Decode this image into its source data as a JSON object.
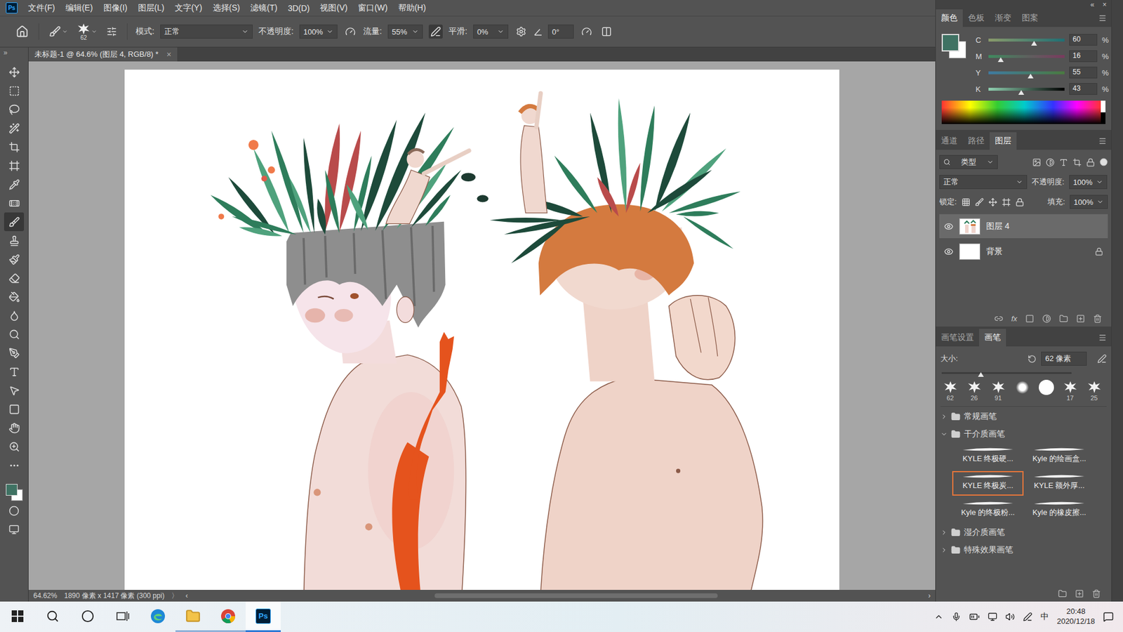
{
  "app": {
    "logo": "Ps"
  },
  "menu": [
    "文件(F)",
    "编辑(E)",
    "图像(I)",
    "图层(L)",
    "文字(Y)",
    "选择(S)",
    "滤镜(T)",
    "3D(D)",
    "视图(V)",
    "窗口(W)",
    "帮助(H)"
  ],
  "options_bar": {
    "brush_size": "62",
    "mode_label": "模式:",
    "mode": "正常",
    "opacity_label": "不透明度:",
    "opacity": "100%",
    "flow_label": "流量:",
    "flow": "55%",
    "airbrush_on": true,
    "smoothing_label": "平滑:",
    "smoothing": "0%",
    "angle": "0°"
  },
  "document_tab": {
    "title": "未标题-1 @ 64.6% (图层 4, RGB/8) *",
    "close": "×"
  },
  "toolbar": {
    "collapse": "»",
    "tools": [
      {
        "selected": false
      },
      {
        "selected": false
      },
      {
        "selected": false
      },
      {
        "selected": false
      },
      {
        "selected": false
      },
      {
        "selected": false
      },
      {
        "selected": false
      },
      {
        "selected": false
      },
      {
        "selected": true
      },
      {
        "selected": false
      },
      {
        "selected": false
      },
      {
        "selected": false
      },
      {
        "selected": false
      },
      {
        "selected": false
      },
      {
        "selected": false
      },
      {
        "selected": false
      },
      {
        "selected": false
      },
      {
        "selected": false
      },
      {
        "selected": false
      },
      {
        "selected": false
      },
      {
        "selected": false
      },
      {
        "selected": false
      }
    ]
  },
  "dock_controls": [
    "«",
    "×"
  ],
  "color_panel": {
    "tabs": [
      {
        "label": "颜色",
        "selected": true
      },
      {
        "label": "色板",
        "selected": false
      },
      {
        "label": "渐变",
        "selected": false
      },
      {
        "label": "图案",
        "selected": false
      }
    ],
    "foreground": "#3f7263",
    "background": "#ffffff",
    "channels": [
      {
        "name": "C",
        "value": "60",
        "unit": "%",
        "level": 0.6
      },
      {
        "name": "M",
        "value": "16",
        "unit": "%",
        "level": 0.16
      },
      {
        "name": "Y",
        "value": "55",
        "unit": "%",
        "level": 0.55
      },
      {
        "name": "K",
        "value": "43",
        "unit": "%",
        "level": 0.43
      }
    ]
  },
  "layers_panel": {
    "tabs": [
      {
        "label": "通道",
        "selected": false
      },
      {
        "label": "路径",
        "selected": false
      },
      {
        "label": "图层",
        "selected": true
      }
    ],
    "filter": "类型",
    "blend_mode": "正常",
    "opacity_label": "不透明度:",
    "opacity": "100%",
    "lock_label": "锁定:",
    "fill_label": "填充:",
    "fill": "100%",
    "fx": "fx",
    "layers": [
      {
        "name": "图层 4",
        "visible": true,
        "selected": true,
        "locked": false,
        "kind": "art"
      },
      {
        "name": "背景",
        "visible": true,
        "selected": false,
        "locked": true,
        "kind": "fill"
      }
    ]
  },
  "brushes_panel": {
    "tabs": [
      {
        "label": "画笔设置",
        "selected": false
      },
      {
        "label": "画笔",
        "selected": true
      }
    ],
    "size_label": "大小:",
    "size": "62 像素",
    "size_level": 0.3,
    "presets": [
      {
        "size": "62",
        "kind": "splat"
      },
      {
        "size": "26",
        "kind": "splat"
      },
      {
        "size": "91",
        "kind": "splat"
      },
      {
        "kind": "soft"
      },
      {
        "kind": "hard"
      },
      {
        "size": "17",
        "kind": "splat"
      },
      {
        "size": "25",
        "kind": "splat"
      }
    ],
    "groups": [
      {
        "name": "常规画笔",
        "expanded": false,
        "brushes": []
      },
      {
        "name": "干介质画笔",
        "expanded": true,
        "brushes": [
          {
            "name": "KYLE 终极硬...",
            "selected": false
          },
          {
            "name": "Kyle 的绘画盒...",
            "selected": false
          },
          {
            "name": "KYLE 终极炭...",
            "selected": true
          },
          {
            "name": "KYLE 额外厚...",
            "selected": false
          },
          {
            "name": "Kyle 的终极粉...",
            "selected": false
          },
          {
            "name": "Kyle 的橡皮擦...",
            "selected": false
          }
        ]
      },
      {
        "name": "湿介质画笔",
        "expanded": false,
        "brushes": []
      },
      {
        "name": "特殊效果画笔",
        "expanded": false,
        "brushes": []
      }
    ]
  },
  "status_bar": {
    "zoom": "64.62%",
    "info": "1890 像素 x 1417 像素 (300 ppi)",
    "more": "〉",
    "scroll_left": "‹",
    "scroll_right": "›",
    "scroll_start": 0.33,
    "scroll_extent": 0.39
  },
  "taskbar": {
    "apps": [
      {
        "running": false,
        "selected": false
      },
      {
        "running": true,
        "selected": false
      },
      {
        "running": true,
        "selected": false
      },
      {
        "running": true,
        "selected": true
      }
    ],
    "input_method": "中",
    "time": "20:48",
    "date": "2020/12/18"
  }
}
